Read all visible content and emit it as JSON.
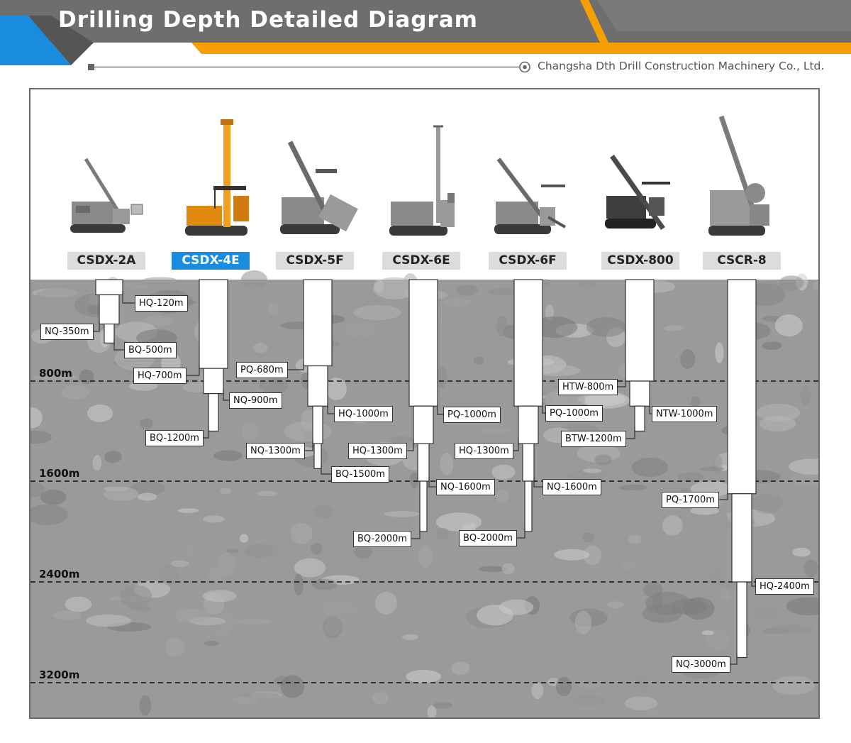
{
  "header": {
    "title": "Drilling Depth Detailed Diagram",
    "company": "Changsha Dth Drill Construction Machinery Co., Ltd.",
    "colors": {
      "accent_blue": "#1a8ce0",
      "accent_orange": "#f5a000",
      "band_gray": "#6e6e6e"
    }
  },
  "models": [
    {
      "id": "m1",
      "label": "CSDX-2A",
      "highlighted": false,
      "icon": "drill-rig-icon"
    },
    {
      "id": "m2",
      "label": "CSDX-4E",
      "highlighted": true,
      "icon": "drill-rig-icon"
    },
    {
      "id": "m3",
      "label": "CSDX-5F",
      "highlighted": false,
      "icon": "drill-rig-icon"
    },
    {
      "id": "m4",
      "label": "CSDX-6E",
      "highlighted": false,
      "icon": "drill-rig-icon"
    },
    {
      "id": "m5",
      "label": "CSDX-6F",
      "highlighted": false,
      "icon": "drill-rig-icon"
    },
    {
      "id": "m6",
      "label": "CSDX-800",
      "highlighted": false,
      "icon": "drill-rig-icon"
    },
    {
      "id": "m7",
      "label": "CSCR-8",
      "highlighted": false,
      "icon": "drill-rig-icon"
    }
  ],
  "depth_marks": [
    {
      "label": "800m",
      "depth": 800
    },
    {
      "label": "1600m",
      "depth": 1600
    },
    {
      "label": "2400m",
      "depth": 2400
    },
    {
      "label": "3200m",
      "depth": 3200
    }
  ],
  "capacities": [
    {
      "model": "CSDX-2A",
      "items": [
        {
          "label": "HQ-120m",
          "size": "HQ",
          "depth": 120
        },
        {
          "label": "NQ-350m",
          "size": "NQ",
          "depth": 350
        },
        {
          "label": "BQ-500m",
          "size": "BQ",
          "depth": 500
        }
      ]
    },
    {
      "model": "CSDX-4E",
      "items": [
        {
          "label": "HQ-700m",
          "size": "HQ",
          "depth": 700
        },
        {
          "label": "NQ-900m",
          "size": "NQ",
          "depth": 900
        },
        {
          "label": "BQ-1200m",
          "size": "BQ",
          "depth": 1200
        }
      ]
    },
    {
      "model": "CSDX-5F",
      "items": [
        {
          "label": "PQ-680m",
          "size": "PQ",
          "depth": 680
        },
        {
          "label": "HQ-1000m",
          "size": "HQ",
          "depth": 1000
        },
        {
          "label": "NQ-1300m",
          "size": "NQ",
          "depth": 1300
        },
        {
          "label": "BQ-1500m",
          "size": "BQ",
          "depth": 1500
        }
      ]
    },
    {
      "model": "CSDX-6E",
      "items": [
        {
          "label": "PQ-1000m",
          "size": "PQ",
          "depth": 1000
        },
        {
          "label": "HQ-1300m",
          "size": "HQ",
          "depth": 1300
        },
        {
          "label": "NQ-1600m",
          "size": "NQ",
          "depth": 1600
        },
        {
          "label": "BQ-2000m",
          "size": "BQ",
          "depth": 2000
        }
      ]
    },
    {
      "model": "CSDX-6F",
      "items": [
        {
          "label": "PQ-1000m",
          "size": "PQ",
          "depth": 1000
        },
        {
          "label": "HQ-1300m",
          "size": "HQ",
          "depth": 1300
        },
        {
          "label": "NQ-1600m",
          "size": "NQ",
          "depth": 1600
        },
        {
          "label": "BQ-2000m",
          "size": "BQ",
          "depth": 2000
        }
      ]
    },
    {
      "model": "CSDX-800",
      "items": [
        {
          "label": "HTW-800m",
          "size": "HTW",
          "depth": 800
        },
        {
          "label": "NTW-1000m",
          "size": "NTW",
          "depth": 1000
        },
        {
          "label": "BTW-1200m",
          "size": "BTW",
          "depth": 1200
        }
      ]
    },
    {
      "model": "CSCR-8",
      "items": [
        {
          "label": "PQ-1700m",
          "size": "PQ",
          "depth": 1700
        },
        {
          "label": "HQ-2400m",
          "size": "HQ",
          "depth": 2400
        },
        {
          "label": "NQ-3000m",
          "size": "NQ",
          "depth": 3000
        }
      ]
    }
  ]
}
